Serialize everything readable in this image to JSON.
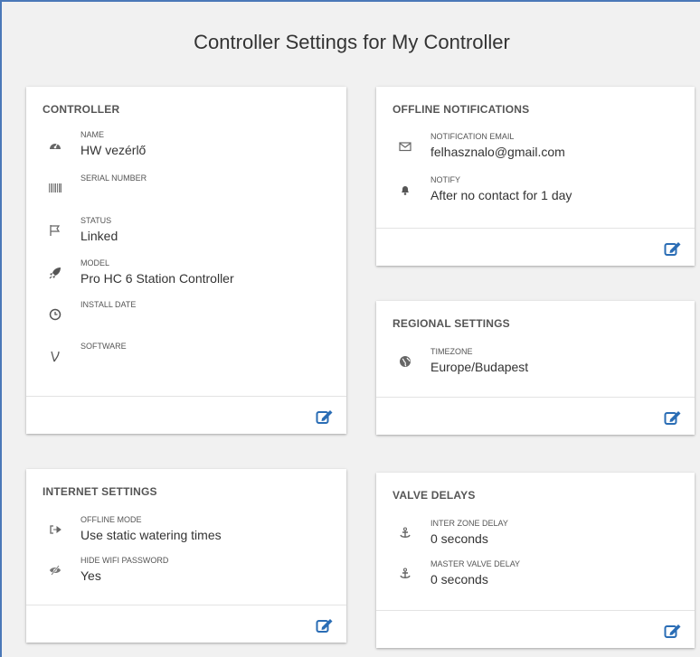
{
  "page": {
    "title": "Controller Settings for My Controller"
  },
  "controller": {
    "title": "CONTROLLER",
    "fields": [
      {
        "label": "NAME",
        "value": "HW vezérlő",
        "icon": "dashboard-icon"
      },
      {
        "label": "SERIAL NUMBER",
        "value": "",
        "icon": "barcode-icon"
      },
      {
        "label": "STATUS",
        "value": "Linked",
        "icon": "flag-icon"
      },
      {
        "label": "MODEL",
        "value": "Pro HC 6 Station Controller",
        "icon": "rocket-icon"
      },
      {
        "label": "INSTALL DATE",
        "value": "",
        "icon": "clock-icon"
      },
      {
        "label": "SOFTWARE",
        "value": "",
        "icon": "software-icon"
      }
    ]
  },
  "offline_notifications": {
    "title": "OFFLINE NOTIFICATIONS",
    "fields": [
      {
        "label": "NOTIFICATION EMAIL",
        "value": "felhasznalo@gmail.com",
        "icon": "envelope-icon"
      },
      {
        "label": "NOTIFY",
        "value": "After no contact for 1 day",
        "icon": "bell-icon"
      }
    ]
  },
  "regional_settings": {
    "title": "REGIONAL SETTINGS",
    "fields": [
      {
        "label": "TIMEZONE",
        "value": "Europe/Budapest",
        "icon": "globe-icon"
      }
    ]
  },
  "internet_settings": {
    "title": "INTERNET SETTINGS",
    "fields": [
      {
        "label": "OFFLINE MODE",
        "value": "Use static watering times",
        "icon": "sign-out-icon"
      },
      {
        "label": "HIDE WIFI PASSWORD",
        "value": "Yes",
        "icon": "eye-slash-icon"
      }
    ]
  },
  "valve_delays": {
    "title": "VALVE DELAYS",
    "fields": [
      {
        "label": "INTER ZONE DELAY",
        "value": "0 seconds",
        "icon": "anchor-icon"
      },
      {
        "label": "MASTER VALVE DELAY",
        "value": "0 seconds",
        "icon": "anchor-icon"
      }
    ]
  },
  "colors": {
    "accent": "#2a6db5",
    "border": "#4a78b8"
  }
}
